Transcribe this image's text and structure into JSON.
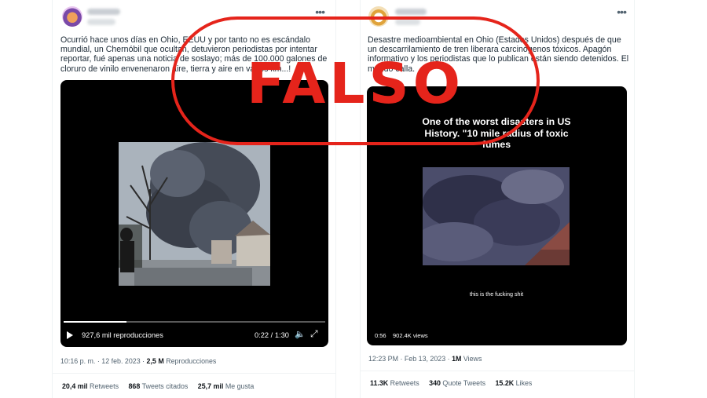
{
  "tweet_left": {
    "text": "Ocurrió hace unos días en Ohio, EEUU y por tanto no es escándalo mundial, un Chernóbil que ocultan, detuvieron periodistas por intentar reportar, fué apenas una noticia de soslayo; más de 100.000 galones de cloruro de vinilo envenenaron aire, tierra y aire en varios km...!",
    "video": {
      "views": "927,6 mil reproducciones",
      "time": "0:22 / 1:30",
      "progress_fraction": 0.24
    },
    "timestamp": "10:16 p. m. · 12 feb. 2023 ·",
    "views_count": "2,5 M",
    "views_label": "Reproducciones",
    "stats": [
      {
        "value": "20,4 mil",
        "label": "Retweets"
      },
      {
        "value": "868",
        "label": "Tweets citados"
      },
      {
        "value": "25,7 mil",
        "label": "Me gusta"
      }
    ]
  },
  "tweet_right": {
    "text": "Desastre medioambiental en Ohio (Estados Unidos) después de que un descarrilamiento de tren liberara carcinógenos tóxicos. Apagón informativo y los periodistas que lo publican están siendo detenidos. El mundo calla.",
    "video": {
      "overlay_title": "One of the worst disasters in US History. \"10 mile radius of toxic fumes",
      "caption": "this is the fucking shit",
      "time": "0:56",
      "views": "902.4K views"
    },
    "timestamp": "12:23 PM · Feb 13, 2023 ·",
    "views_count": "1M",
    "views_label": "Views",
    "stats": [
      {
        "value": "11.3K",
        "label": "Retweets"
      },
      {
        "value": "340",
        "label": "Quote Tweets"
      },
      {
        "value": "15.2K",
        "label": "Likes"
      }
    ]
  },
  "stamp": {
    "text": "FALSO",
    "color": "#e5241b"
  },
  "icons": {
    "more": "more-dots-icon",
    "play": "play-icon",
    "volume": "volume-icon",
    "fullscreen": "fullscreen-icon"
  }
}
